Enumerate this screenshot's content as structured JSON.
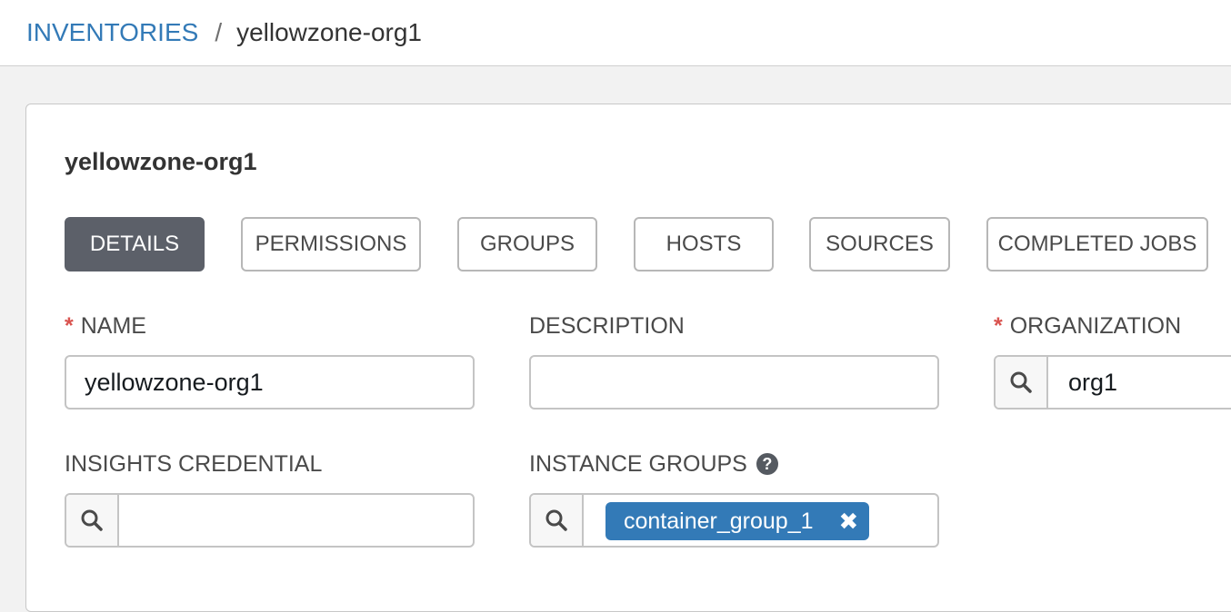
{
  "breadcrumb": {
    "parent": "INVENTORIES",
    "separator": "/",
    "current": "yellowzone-org1"
  },
  "panel": {
    "title": "yellowzone-org1"
  },
  "tabs": [
    {
      "label": "DETAILS",
      "active": true
    },
    {
      "label": "PERMISSIONS",
      "active": false
    },
    {
      "label": "GROUPS",
      "active": false
    },
    {
      "label": "HOSTS",
      "active": false
    },
    {
      "label": "SOURCES",
      "active": false
    },
    {
      "label": "COMPLETED JOBS",
      "active": false
    }
  ],
  "form": {
    "name": {
      "label": "NAME",
      "required_mark": "*",
      "value": "yellowzone-org1"
    },
    "description": {
      "label": "DESCRIPTION",
      "value": ""
    },
    "organization": {
      "label": "ORGANIZATION",
      "required_mark": "*",
      "value": "org1"
    },
    "insights_credential": {
      "label": "INSIGHTS CREDENTIAL",
      "value": ""
    },
    "instance_groups": {
      "label": "INSTANCE GROUPS",
      "help_icon": "question-circle-icon",
      "help_glyph": "?",
      "chips": [
        "container_group_1"
      ],
      "chip_remove_glyph": "✖"
    }
  },
  "icons": {
    "lookup": "search-icon"
  },
  "colors": {
    "link": "#337ab7",
    "active_tab": "#5c6069",
    "required": "#d9534f",
    "chip": "#337ab7"
  }
}
